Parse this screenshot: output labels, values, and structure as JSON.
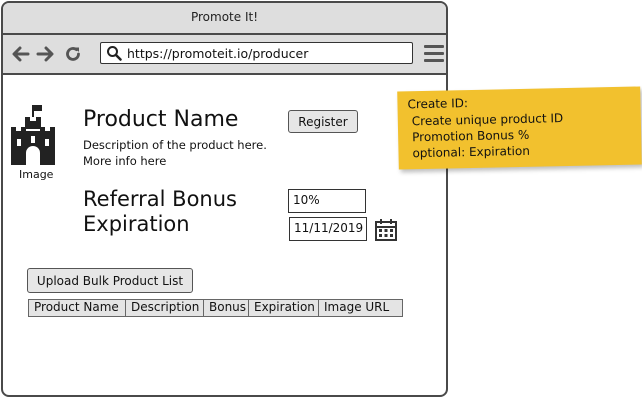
{
  "window": {
    "title": "Promote It!"
  },
  "toolbar": {
    "url": "https://promoteit.io/producer",
    "icons": [
      "back-arrow-icon",
      "forward-arrow-icon",
      "refresh-icon",
      "search-icon",
      "hamburger-menu-icon"
    ]
  },
  "product": {
    "image_label": "Image",
    "name": "Product Name",
    "description_line1": "Description of the product here.",
    "description_line2": "More info here",
    "register_label": "Register"
  },
  "referral": {
    "bonus_label": "Referral Bonus",
    "bonus_value": "10%",
    "expiration_label": "Expiration",
    "expiration_value": "11/11/2019"
  },
  "upload": {
    "label": "Upload Bulk Product List"
  },
  "table": {
    "headers": [
      "Product Name",
      "Description",
      "Bonus",
      "Expiration",
      "Image URL"
    ]
  },
  "note": {
    "title": "Create ID:",
    "lines": [
      "Create unique product ID",
      "Promotion Bonus %",
      "optional: Expiration"
    ],
    "color": "#f2c12e"
  }
}
